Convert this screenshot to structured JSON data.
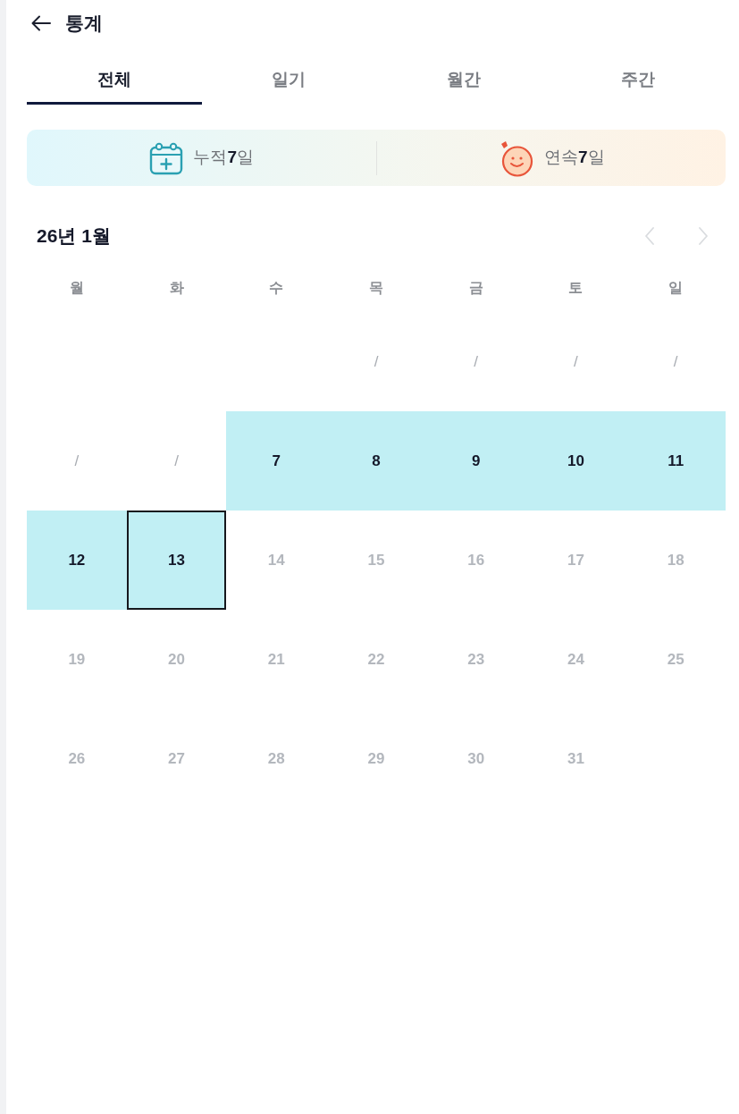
{
  "header": {
    "title": "통계"
  },
  "tabs": [
    {
      "label": "전체",
      "selected": true
    },
    {
      "label": "일기",
      "selected": false
    },
    {
      "label": "월간",
      "selected": false
    },
    {
      "label": "주간",
      "selected": false
    }
  ],
  "summary": [
    {
      "kind": "calendar",
      "text": "누적**7**일"
    },
    {
      "kind": "streak",
      "text": "연속**7**일"
    }
  ],
  "calendar": {
    "title": "26년 1월",
    "nav": [
      {
        "kind": "prev",
        "disabled": true
      },
      {
        "kind": "next",
        "disabled": true
      }
    ],
    "weekdays": [
      "월",
      "화",
      "수",
      "목",
      "금",
      "토",
      "일"
    ],
    "weeks": [
      {
        "days": [
          {
            "kind": "empty"
          },
          {
            "kind": "empty"
          },
          {
            "kind": "empty"
          },
          {
            "kind": "missed",
            "label": "/",
            "recorded": false,
            "today": false
          },
          {
            "kind": "missed",
            "label": "/",
            "recorded": false,
            "today": false
          },
          {
            "kind": "missed",
            "label": "/",
            "recorded": false,
            "today": false
          },
          {
            "kind": "missed",
            "label": "/",
            "recorded": false,
            "today": false
          }
        ]
      },
      {
        "days": [
          {
            "kind": "missed",
            "label": "/",
            "recorded": false,
            "today": false
          },
          {
            "kind": "missed",
            "label": "/",
            "recorded": false,
            "today": false
          },
          {
            "kind": "day",
            "label": "7",
            "recorded": true,
            "today": false
          },
          {
            "kind": "day",
            "label": "8",
            "recorded": true,
            "today": false
          },
          {
            "kind": "day",
            "label": "9",
            "recorded": true,
            "today": false
          },
          {
            "kind": "day",
            "label": "10",
            "recorded": true,
            "today": false
          },
          {
            "kind": "day",
            "label": "11",
            "recorded": true,
            "today": false
          }
        ]
      },
      {
        "days": [
          {
            "kind": "day",
            "label": "12",
            "recorded": true,
            "today": false
          },
          {
            "kind": "day",
            "label": "13",
            "recorded": true,
            "today": true
          },
          {
            "kind": "day",
            "label": "14",
            "recorded": false,
            "today": false
          },
          {
            "kind": "day",
            "label": "15",
            "recorded": false,
            "today": false
          },
          {
            "kind": "day",
            "label": "16",
            "recorded": false,
            "today": false
          },
          {
            "kind": "day",
            "label": "17",
            "recorded": false,
            "today": false
          },
          {
            "kind": "day",
            "label": "18",
            "recorded": false,
            "today": false
          }
        ]
      },
      {
        "days": [
          {
            "kind": "day",
            "label": "19",
            "recorded": false,
            "today": false
          },
          {
            "kind": "day",
            "label": "20",
            "recorded": false,
            "today": false
          },
          {
            "kind": "day",
            "label": "21",
            "recorded": false,
            "today": false
          },
          {
            "kind": "day",
            "label": "22",
            "recorded": false,
            "today": false
          },
          {
            "kind": "day",
            "label": "23",
            "recorded": false,
            "today": false
          },
          {
            "kind": "day",
            "label": "24",
            "recorded": false,
            "today": false
          },
          {
            "kind": "day",
            "label": "25",
            "recorded": false,
            "today": false
          }
        ]
      },
      {
        "days": [
          {
            "kind": "day",
            "label": "26",
            "recorded": false,
            "today": false
          },
          {
            "kind": "day",
            "label": "27",
            "recorded": false,
            "today": false
          },
          {
            "kind": "day",
            "label": "28",
            "recorded": false,
            "today": false
          },
          {
            "kind": "day",
            "label": "29",
            "recorded": false,
            "today": false
          },
          {
            "kind": "day",
            "label": "30",
            "recorded": false,
            "today": false
          },
          {
            "kind": "day",
            "label": "31",
            "recorded": false,
            "today": false
          }
        ]
      }
    ]
  }
}
